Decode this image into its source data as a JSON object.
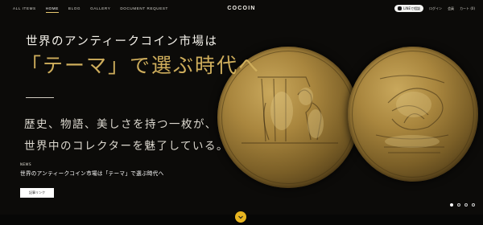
{
  "nav": {
    "items": [
      {
        "label": "ALL ITEMS",
        "active": false
      },
      {
        "label": "HOME",
        "active": true
      },
      {
        "label": "BLOG",
        "active": false
      },
      {
        "label": "GALLERY",
        "active": false
      },
      {
        "label": "DOCUMENT REQUEST",
        "active": false
      }
    ]
  },
  "logo": "COCOIN",
  "header_right": {
    "line_button": "LINEで相談",
    "links": [
      "ログイン",
      "会員",
      "カート (0)"
    ]
  },
  "hero": {
    "title": "世界のアンティークコイン市場は",
    "theme": "「テーマ」で選ぶ時代へ",
    "subtitle_lines": [
      "歴史、物語、美しさを持つ一枚が、",
      "世界中のコレクターを魅了している。"
    ]
  },
  "news": {
    "label": "NEWS",
    "title": "世界のアンティークコイン市場は「テーマ」で選ぶ時代へ",
    "button": "記事リンク"
  },
  "carousel": {
    "count": 4,
    "active_index": 0
  },
  "colors": {
    "accent_gold": "#cfae5c",
    "scroll_button": "#e8b520",
    "background": "#0c0b09"
  },
  "icons": {
    "scroll": "chevron-down-icon",
    "line": "line-icon"
  }
}
